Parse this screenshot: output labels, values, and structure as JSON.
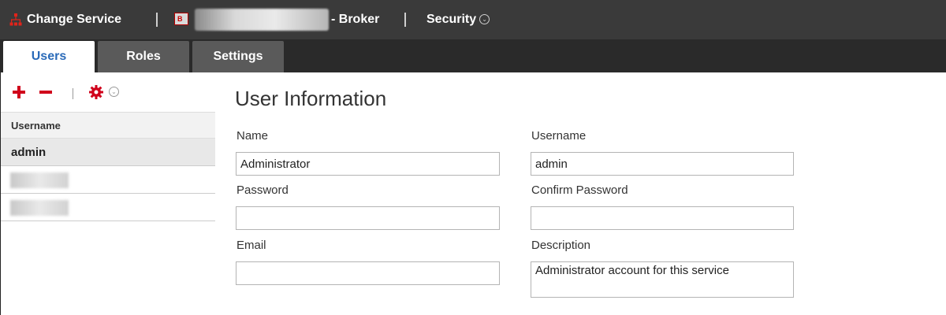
{
  "header": {
    "change_service": "Change Service",
    "broker": "- Broker",
    "security": "Security"
  },
  "tabs": [
    {
      "label": "Users"
    },
    {
      "label": "Roles"
    },
    {
      "label": "Settings"
    }
  ],
  "users_list": {
    "column_header": "Username",
    "rows": [
      "admin"
    ]
  },
  "user_info": {
    "title": "User Information",
    "name_label": "Name",
    "name_value": "Administrator",
    "username_label": "Username",
    "username_value": "admin",
    "password_label": "Password",
    "password_value": "",
    "confirm_password_label": "Confirm Password",
    "confirm_password_value": "",
    "email_label": "Email",
    "email_value": "",
    "description_label": "Description",
    "description_value": "Administrator account for this service"
  },
  "colors": {
    "header_bg": "#3a3a3a",
    "tab_active_text": "#2a6ab8",
    "accent_red": "#d0021b"
  }
}
